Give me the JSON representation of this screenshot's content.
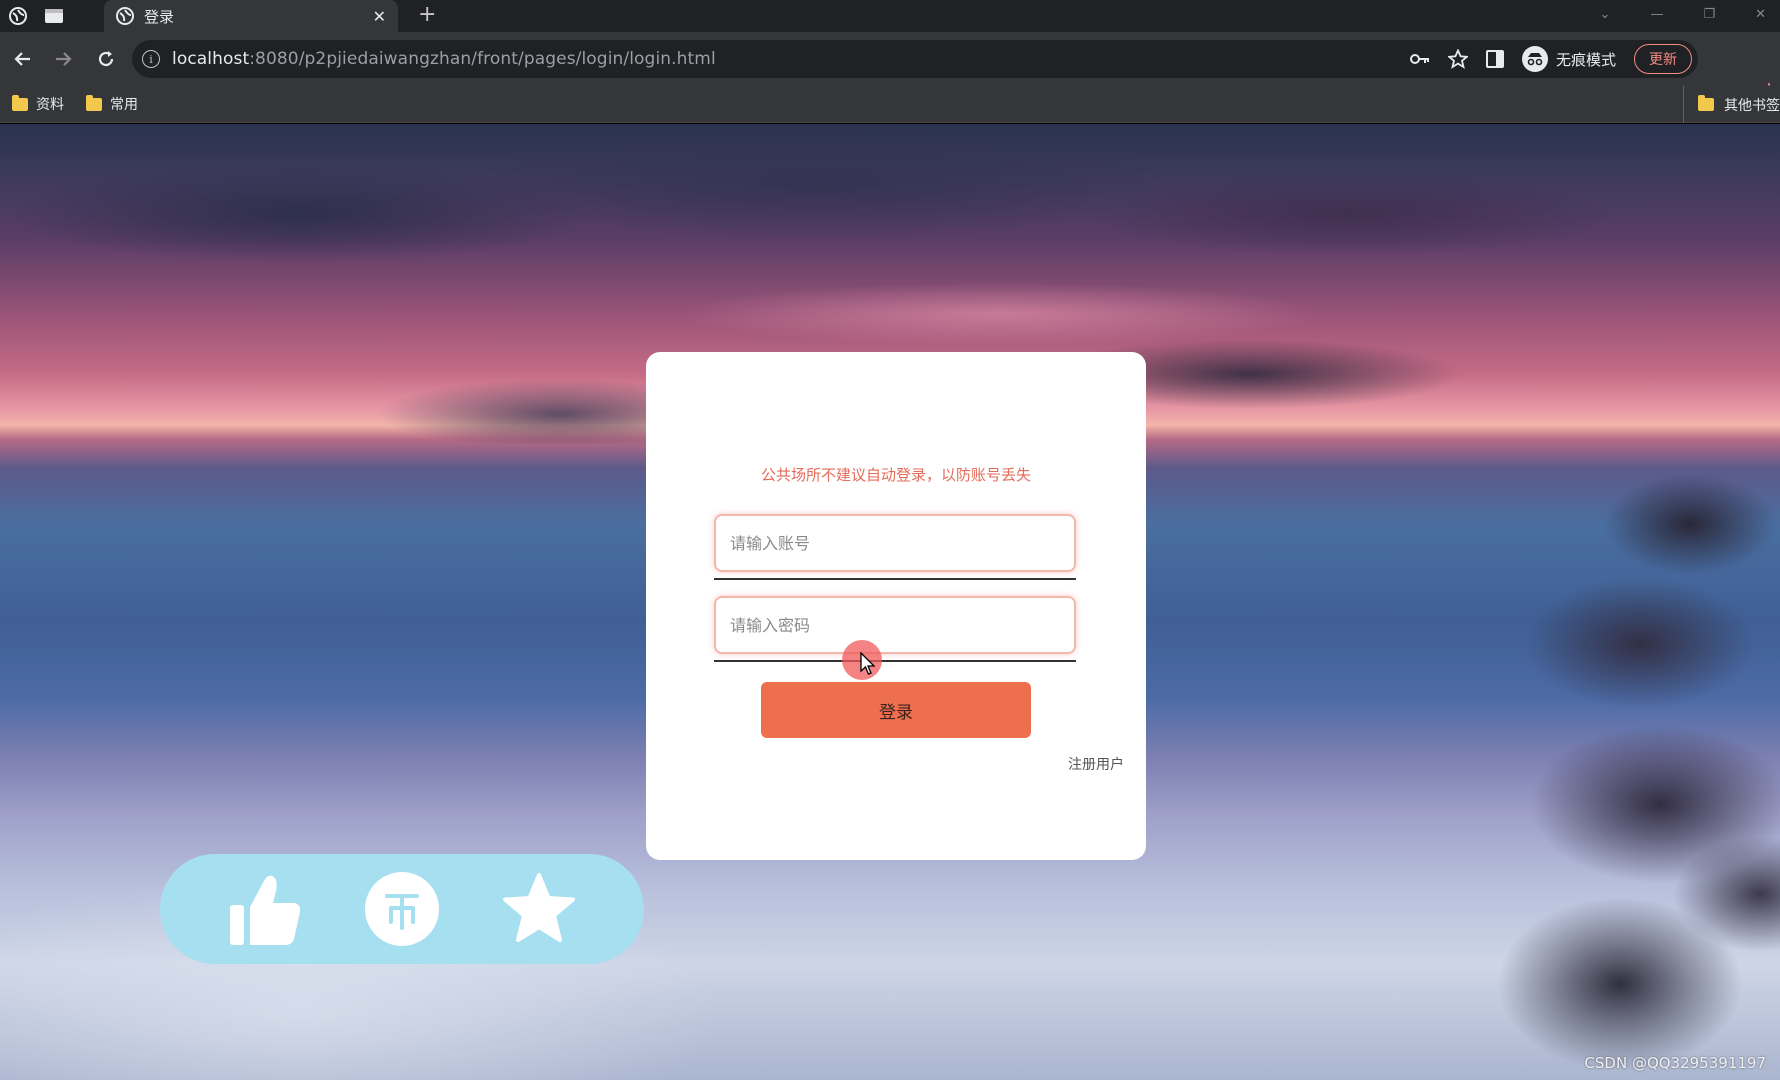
{
  "browser": {
    "tab": {
      "title": "登录",
      "close_glyph": "✕"
    },
    "new_tab_glyph": "+",
    "url": {
      "host": "localhost",
      "rest": ":8080/p2pjiedaiwangzhan/front/pages/login/login.html"
    },
    "incognito_label": "无痕模式",
    "update_label": "更新",
    "bookmarks": [
      {
        "label": "资料"
      },
      {
        "label": "常用"
      }
    ],
    "other_bookmarks_label": "其他书签"
  },
  "login": {
    "notice": "公共场所不建议自动登录，以防账号丢失",
    "username_placeholder": "请输入账号",
    "password_placeholder": "请输入密码",
    "submit_label": "登录",
    "register_label": "注册用户"
  },
  "actions": [
    {
      "icon": "thumbs-up-icon"
    },
    {
      "icon": "coin-icon"
    },
    {
      "icon": "star-icon"
    }
  ],
  "watermark": "CSDN @QQ3295391197",
  "colors": {
    "notice": "#e56b5a",
    "button": "#ee6f4d",
    "pill": "#a5dff0",
    "field_border": "#f4b7ae"
  }
}
